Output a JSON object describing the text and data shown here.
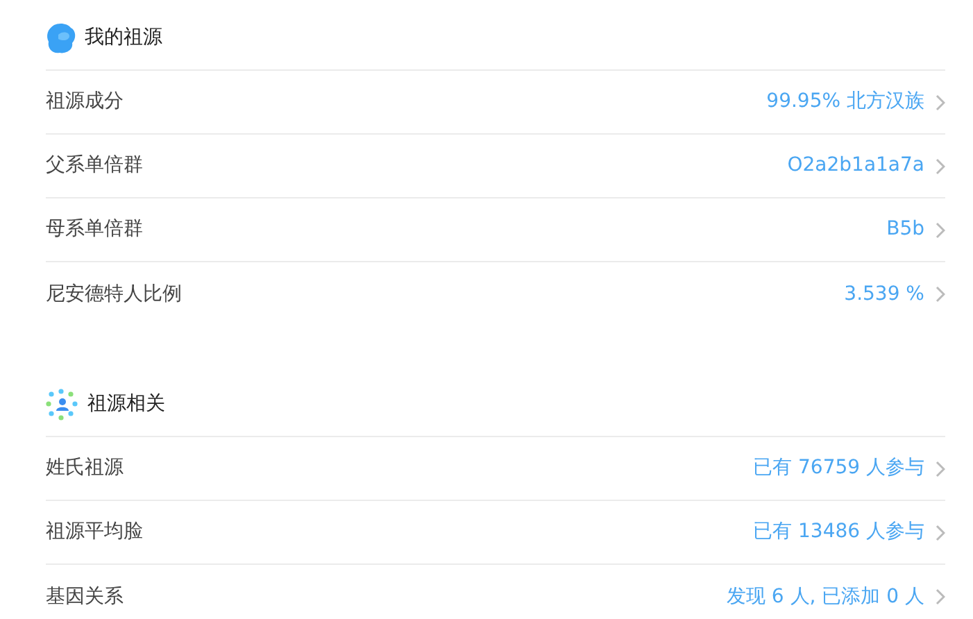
{
  "sections": [
    {
      "title": "我的祖源",
      "rows": [
        {
          "label": "祖源成分",
          "value": "99.95% 北方汉族"
        },
        {
          "label": "父系单倍群",
          "value": "O2a2b1a1a7a"
        },
        {
          "label": "母系单倍群",
          "value": "B5b"
        },
        {
          "label": "尼安德特人比例",
          "value": "3.539 %"
        }
      ]
    },
    {
      "title": "祖源相关",
      "rows": [
        {
          "label": "姓氏祖源",
          "value": "已有 76759 人参与"
        },
        {
          "label": "祖源平均脸",
          "value": "已有 13486 人参与"
        },
        {
          "label": "基因关系",
          "value": "发现 6 人, 已添加 0 人"
        }
      ]
    }
  ]
}
